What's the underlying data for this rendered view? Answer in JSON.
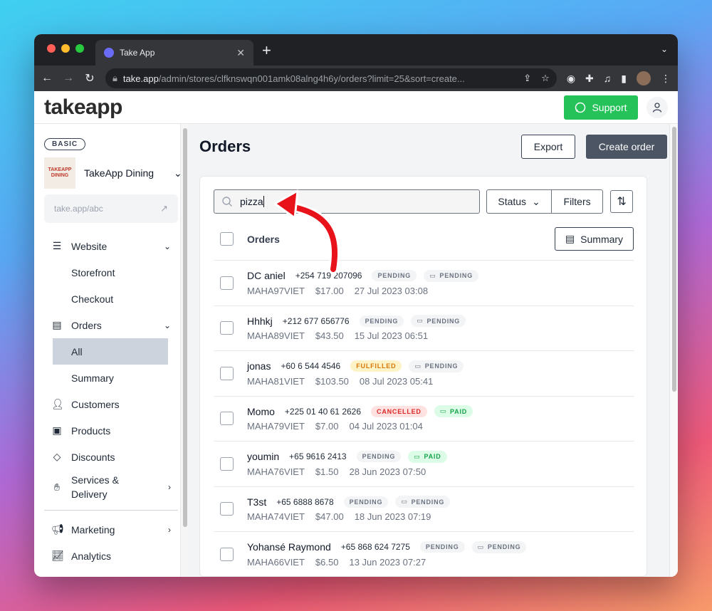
{
  "browser": {
    "tab_title": "Take App",
    "url_host": "take.app",
    "url_path": "/admin/stores/clfknswqn001amk08alng4h6y/orders?limit=25&sort=create..."
  },
  "header": {
    "logo": "takeapp",
    "support_label": "Support"
  },
  "sidebar": {
    "plan_badge": "BASIC",
    "store_logo_text": "TAKEAPP DINING",
    "store_name": "TakeApp Dining",
    "store_link": "take.app/abc",
    "items": {
      "website": "Website",
      "storefront": "Storefront",
      "checkout": "Checkout",
      "orders": "Orders",
      "all": "All",
      "summary": "Summary",
      "customers": "Customers",
      "products": "Products",
      "discounts": "Discounts",
      "services": "Services &",
      "delivery": "Delivery",
      "marketing": "Marketing",
      "analytics": "Analytics"
    }
  },
  "main": {
    "title": "Orders",
    "export_label": "Export",
    "create_label": "Create order",
    "search_value": "pizza",
    "status_label": "Status",
    "filters_label": "Filters",
    "list_header": "Orders",
    "summary_label": "Summary"
  },
  "orders": [
    {
      "name": "DC aniel",
      "phone": "+254 719 207096",
      "status": "PENDING",
      "payment": "PENDING",
      "code": "MAHA97VIET",
      "amount": "$17.00",
      "date": "27 Jul 2023 03:08"
    },
    {
      "name": "Hhhkj",
      "phone": "+212 677 656776",
      "status": "PENDING",
      "payment": "PENDING",
      "code": "MAHA89VIET",
      "amount": "$43.50",
      "date": "15 Jul 2023 06:51"
    },
    {
      "name": "jonas",
      "phone": "+60 6 544 4546",
      "status": "FULFILLED",
      "payment": "PENDING",
      "code": "MAHA81VIET",
      "amount": "$103.50",
      "date": "08 Jul 2023 05:41"
    },
    {
      "name": "Momo",
      "phone": "+225 01 40 61 2626",
      "status": "CANCELLED",
      "payment": "PAID",
      "code": "MAHA79VIET",
      "amount": "$7.00",
      "date": "04 Jul 2023 01:04"
    },
    {
      "name": "youmin",
      "phone": "+65 9616 2413",
      "status": "PENDING",
      "payment": "PAID",
      "code": "MAHA76VIET",
      "amount": "$1.50",
      "date": "28 Jun 2023 07:50"
    },
    {
      "name": "T3st",
      "phone": "+65 6888 8678",
      "status": "PENDING",
      "payment": "PENDING",
      "code": "MAHA74VIET",
      "amount": "$47.00",
      "date": "18 Jun 2023 07:19"
    },
    {
      "name": "Yohansé Raymond",
      "phone": "+65 868 624 7275",
      "status": "PENDING",
      "payment": "PENDING",
      "code": "MAHA66VIET",
      "amount": "$6.50",
      "date": "13 Jun 2023 07:27"
    }
  ],
  "colors": {
    "support_green": "#25c25a",
    "create_button": "#4b5563",
    "active_nav": "#cdd3dd",
    "arrow_red": "#e8121b"
  }
}
